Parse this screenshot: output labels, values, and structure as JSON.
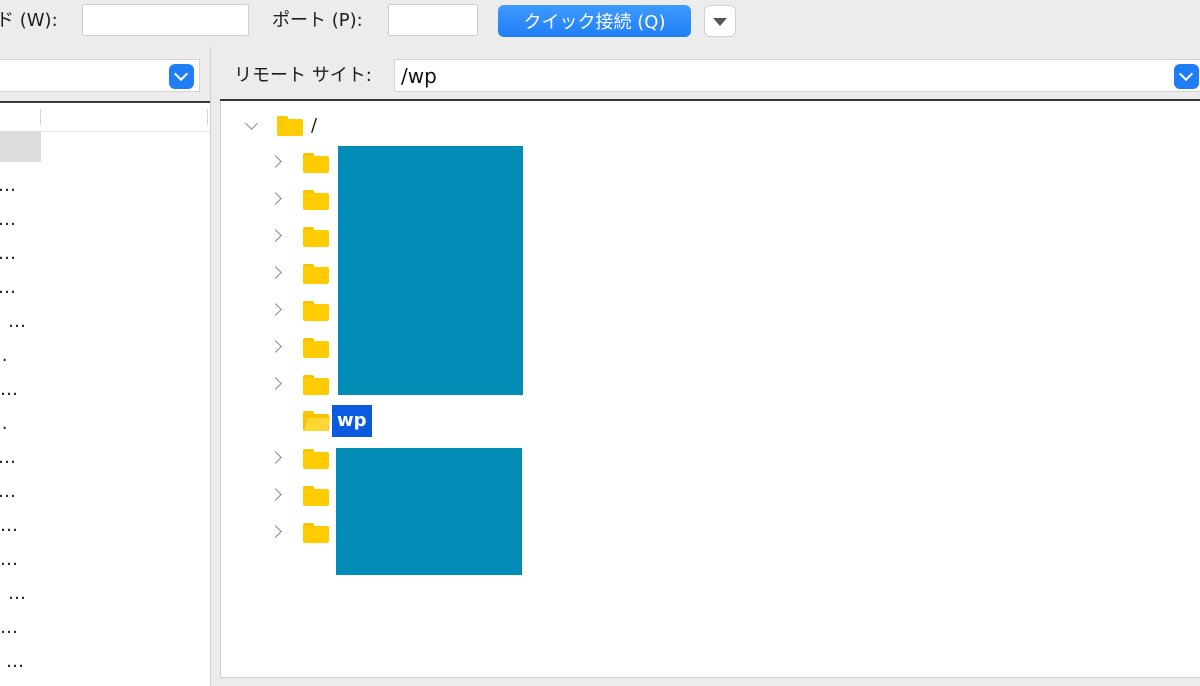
{
  "toolbar": {
    "password_label": "ド (W):",
    "password_value": "",
    "port_label": "ポート (P):",
    "port_value": "",
    "quickconnect_label": "クイック接続 (Q)",
    "quickconnect_dropdown_icon": "triangle-down-icon"
  },
  "local_site": {
    "path_value": "",
    "rows": [
      "",
      "…",
      "…",
      "…",
      "…",
      "…",
      "..",
      "…",
      "..",
      "…",
      "…",
      "…",
      "…",
      "…",
      "…",
      "…"
    ]
  },
  "remote_site": {
    "label": "リモート サイト:",
    "path_value": "/wp",
    "tree": {
      "root_label": "/",
      "selected_label": "wp"
    }
  },
  "colors": {
    "accent_blue": "#1f7ef5",
    "selection_blue": "#0a5be0",
    "folder_yellow": "#ffcc00",
    "redaction_block": "#028db7"
  }
}
